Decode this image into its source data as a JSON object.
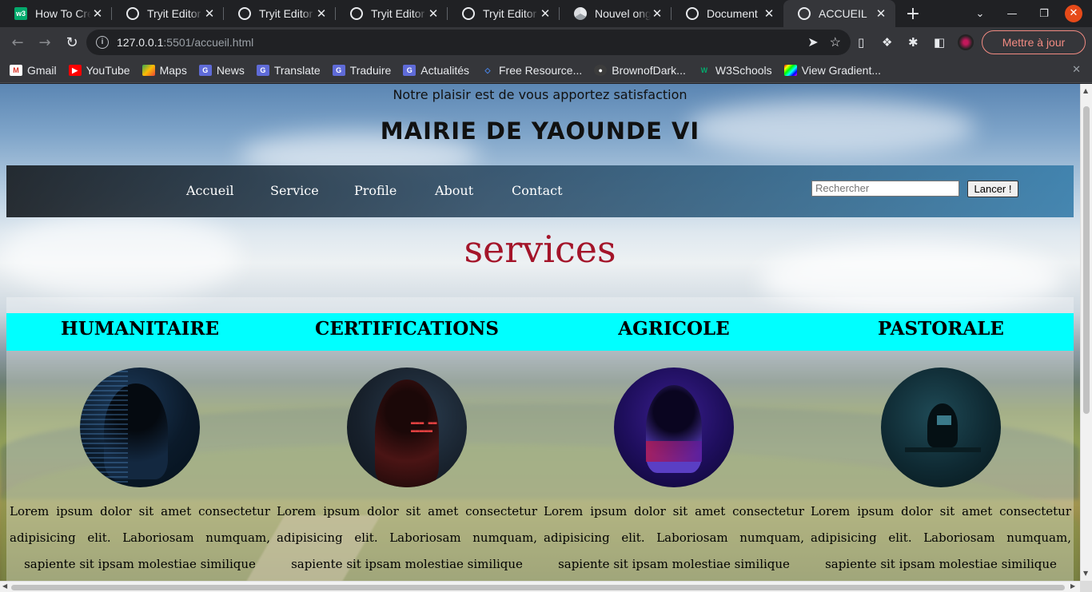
{
  "browser": {
    "tabs": [
      {
        "title": "How To Cre",
        "icon": "w3schools-icon"
      },
      {
        "title": "Tryit Editor",
        "icon": "globe-icon"
      },
      {
        "title": "Tryit Editor",
        "icon": "globe-icon"
      },
      {
        "title": "Tryit Editor",
        "icon": "globe-icon"
      },
      {
        "title": "Tryit Editor",
        "icon": "globe-icon"
      },
      {
        "title": "Nouvel ong",
        "icon": "chrome-icon"
      },
      {
        "title": "Document",
        "icon": "globe-icon"
      },
      {
        "title": "ACCUEIL",
        "icon": "globe-icon",
        "active": true
      }
    ],
    "url_host": "127.0.0.1",
    "url_path": ":5501/accueil.html",
    "update_button": "Mettre à jour",
    "bookmarks": [
      {
        "label": "Gmail",
        "icon": "gmail-icon"
      },
      {
        "label": "YouTube",
        "icon": "youtube-icon"
      },
      {
        "label": "Maps",
        "icon": "maps-icon"
      },
      {
        "label": "News",
        "icon": "news-icon"
      },
      {
        "label": "Translate",
        "icon": "translate-icon"
      },
      {
        "label": "Traduire",
        "icon": "translate-icon"
      },
      {
        "label": "Actualités",
        "icon": "news-icon"
      },
      {
        "label": "Free Resource...",
        "icon": "resource-icon"
      },
      {
        "label": "BrownofDark...",
        "icon": "github-icon"
      },
      {
        "label": "W3Schools",
        "icon": "w3schools-icon"
      },
      {
        "label": "View Gradient...",
        "icon": "gradient-icon"
      }
    ]
  },
  "page": {
    "tagline": "Notre plaisir est de vous apportez satisfaction",
    "brand": "MAIRIE DE YAOUNDE VI",
    "nav": [
      "Accueil",
      "Service",
      "Profile",
      "About",
      "Contact"
    ],
    "search_placeholder": "Rechercher",
    "search_button": "Lancer !",
    "section_title": "services",
    "services": [
      {
        "heading": "HUMANITAIRE",
        "text": "Lorem ipsum dolor sit amet consectetur adipisicing elit. Laboriosam numquam, sapiente sit ipsam molestiae similique"
      },
      {
        "heading": "CERTIFICATIONS",
        "text": "Lorem ipsum dolor sit amet consectetur adipisicing elit. Laboriosam numquam, sapiente sit ipsam molestiae similique"
      },
      {
        "heading": "AGRICOLE",
        "text": "Lorem ipsum dolor sit amet consectetur adipisicing elit. Laboriosam numquam, sapiente sit ipsam molestiae similique"
      },
      {
        "heading": "PASTORALE",
        "text": "Lorem ipsum dolor sit amet consectetur adipisicing elit. Laboriosam numquam, sapiente sit ipsam molestiae similique"
      }
    ]
  },
  "colors": {
    "accent_title": "#a4152a",
    "band": "#00ffff",
    "update_button": "#f28b82"
  }
}
